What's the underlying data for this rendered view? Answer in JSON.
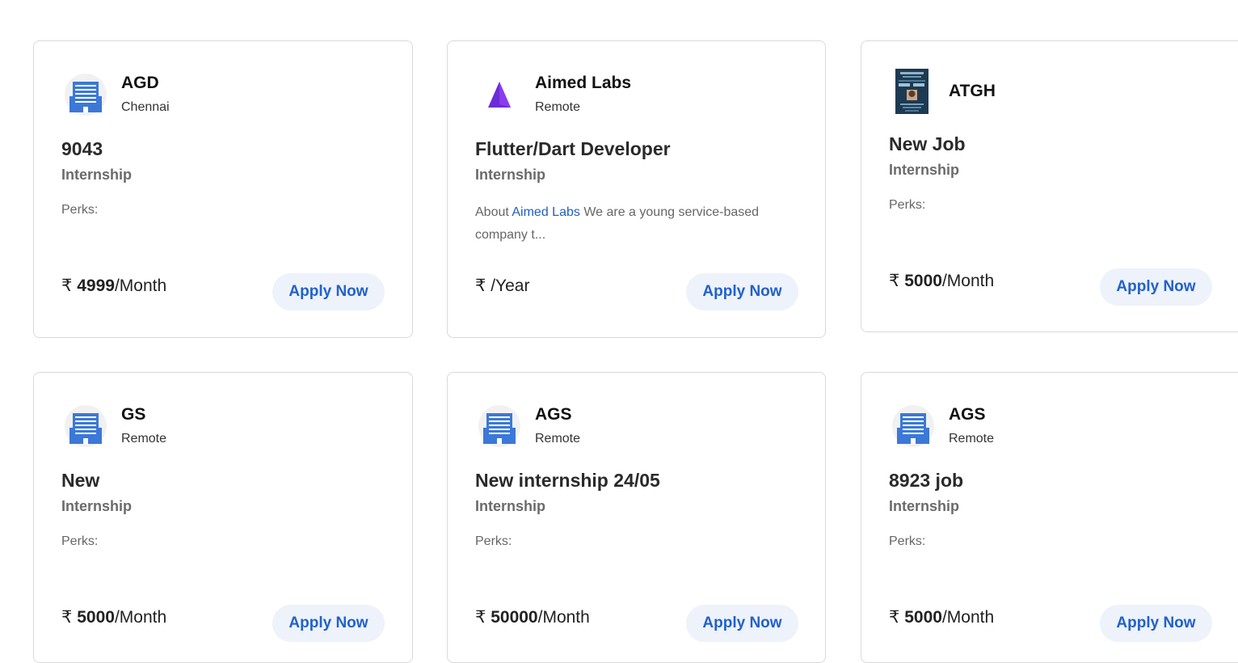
{
  "currency_symbol": "₹",
  "apply_label": "Apply Now",
  "perks_label": "Perks:",
  "cards": [
    {
      "company": "AGD",
      "location": "Chennai",
      "title": "9043",
      "type": "Internship",
      "salary_amount": "4999",
      "salary_period": "/Month",
      "logo": "building-icon"
    },
    {
      "company": "Aimed Labs",
      "location": "Remote",
      "title": "Flutter/Dart Developer",
      "type": "Internship",
      "description_prefix": "About",
      "description_link": "Aimed Labs",
      "description_suffix": "We are a young service-based company t...",
      "salary_amount": "",
      "salary_period": "/Year",
      "logo": "triangle-logo-icon"
    },
    {
      "company": "ATGH",
      "title": "New Job",
      "type": "Internship",
      "salary_amount": "5000",
      "salary_period": "/Month",
      "logo": "poster-image"
    },
    {
      "company": "GS",
      "location": "Remote",
      "title": "New",
      "type": "Internship",
      "salary_amount": "5000",
      "salary_period": "/Month",
      "logo": "building-icon"
    },
    {
      "company": "AGS",
      "location": "Remote",
      "title": "New internship 24/05",
      "type": "Internship",
      "salary_amount": "50000",
      "salary_period": "/Month",
      "logo": "building-icon"
    },
    {
      "company": "AGS",
      "location": "Remote",
      "title": "8923 job",
      "type": "Internship",
      "salary_amount": "5000",
      "salary_period": "/Month",
      "logo": "building-icon"
    }
  ],
  "colors": {
    "accent": "#2261c9",
    "button_bg": "#edf2fb",
    "building_blue": "#3b78d8",
    "triangle_purple": "#6c2bd9"
  }
}
